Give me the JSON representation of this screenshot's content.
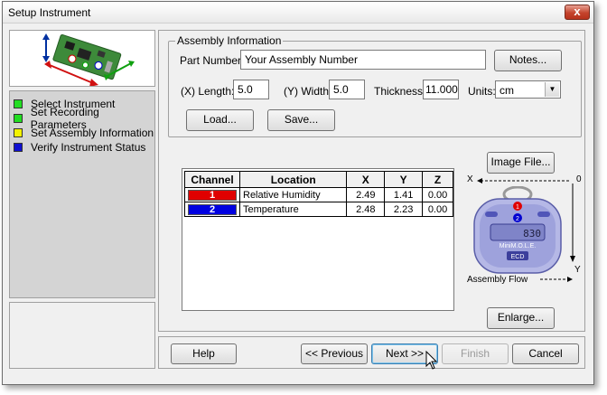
{
  "window": {
    "title": "Setup Instrument",
    "close_glyph": "x"
  },
  "steps": [
    {
      "label": "Select Instrument",
      "color": "#22dd22"
    },
    {
      "label": "Set Recording Parameters",
      "color": "#22dd22"
    },
    {
      "label": "Set Assembly Information",
      "color": "#f2f200"
    },
    {
      "label": "Verify Instrument Status",
      "color": "#1010d0"
    }
  ],
  "assembly": {
    "legend": "Assembly Information",
    "part_number_label": "Part Number:",
    "part_number_value": "Your Assembly Number",
    "notes_button": "Notes...",
    "length_label": "(X) Length:",
    "length_value": "5.0",
    "width_label": "(Y) Width:",
    "width_value": "5.0",
    "thickness_label": "Thickness:",
    "thickness_value": "11.000",
    "units_label": "Units:",
    "units_value": "cm",
    "load_button": "Load...",
    "save_button": "Save..."
  },
  "channels": {
    "headers": [
      "Channel",
      "Location",
      "X",
      "Y",
      "Z"
    ],
    "rows": [
      {
        "channel": "1",
        "location": "Relative Humidity",
        "x": "2.49",
        "y": "1.41",
        "z": "0.00",
        "color": "#e00000"
      },
      {
        "channel": "2",
        "location": "Temperature",
        "x": "2.48",
        "y": "2.23",
        "z": "0.00",
        "color": "#0000e0"
      }
    ]
  },
  "image_panel": {
    "image_file_button": "Image File...",
    "axis_x": "X",
    "axis_y": "Y",
    "axis_origin": "0",
    "flow_label": "Assembly Flow",
    "enlarge_button": "Enlarge...",
    "device_readout": "830",
    "device_brand": "MiniM.O.L.E.",
    "device_badge": "ECD"
  },
  "footer": {
    "help_button": "Help",
    "previous_button": "<< Previous",
    "next_button": "Next >>",
    "finish_button": "Finish",
    "cancel_button": "Cancel"
  }
}
